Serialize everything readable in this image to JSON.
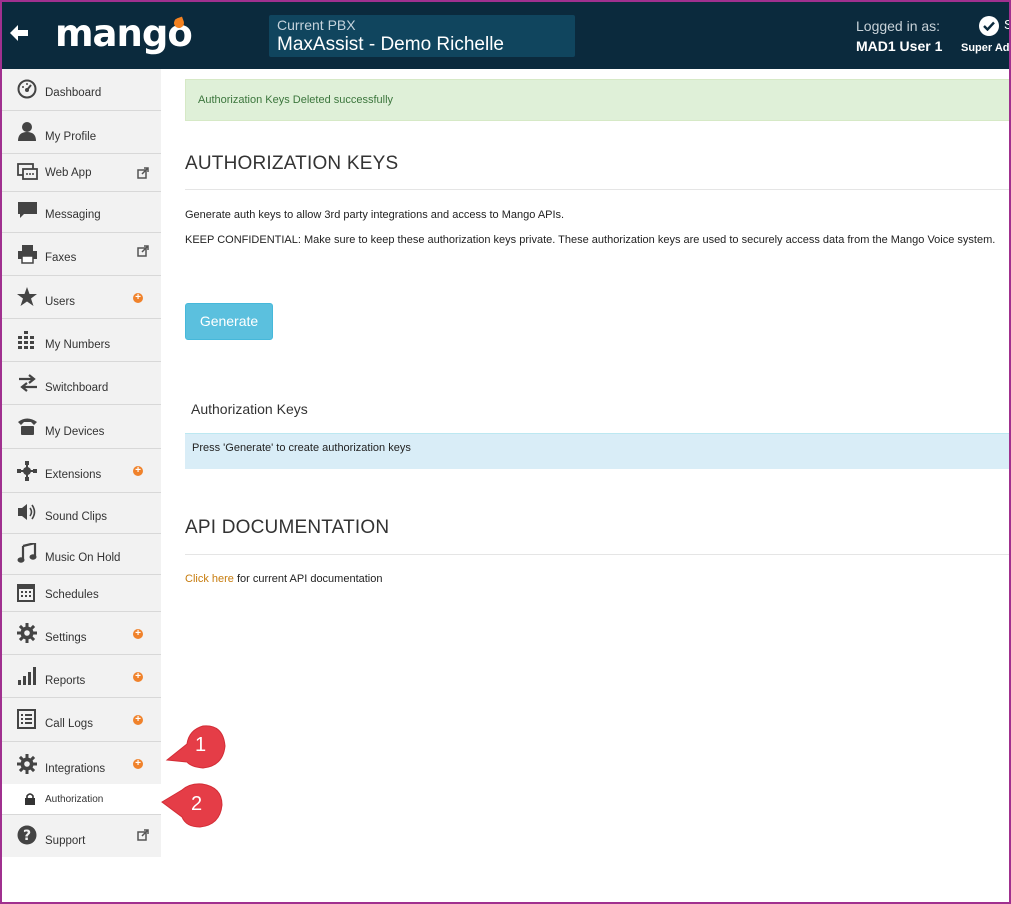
{
  "header": {
    "logo_text": "mango",
    "pbx_caption": "Current PBX",
    "pbx_name": "MaxAssist - Demo Richelle",
    "logged_in_label": "Logged in as:",
    "user_name": "MAD1 User 1",
    "admin_cut_text": "S",
    "admin_label": "Super Admin",
    "bg_color": "#0b2a3d",
    "accent_color": "#f58220"
  },
  "sidebar": {
    "items": [
      {
        "label": "Dashboard",
        "icon": "dashboard-icon"
      },
      {
        "label": "My Profile",
        "icon": "user-icon"
      },
      {
        "label": "Web App",
        "icon": "chat-icon"
      },
      {
        "label": "Messaging",
        "icon": "message-icon"
      },
      {
        "label": "Faxes",
        "icon": "printer-icon"
      },
      {
        "label": "Users",
        "icon": "star-icon"
      },
      {
        "label": "My Numbers",
        "icon": "keypad-icon"
      },
      {
        "label": "Switchboard",
        "icon": "transfer-icon"
      },
      {
        "label": "My Devices",
        "icon": "phone-icon"
      },
      {
        "label": "Extensions",
        "icon": "extensions-icon"
      },
      {
        "label": "Sound Clips",
        "icon": "speaker-icon"
      },
      {
        "label": "Music On Hold",
        "icon": "music-icon"
      },
      {
        "label": "Schedules",
        "icon": "calendar-icon"
      },
      {
        "label": "Settings",
        "icon": "gear-icon"
      },
      {
        "label": "Reports",
        "icon": "bar-chart-icon"
      },
      {
        "label": "Call Logs",
        "icon": "list-icon"
      },
      {
        "label": "Integrations",
        "icon": "gear-icon"
      }
    ],
    "sub_item": {
      "label": "Authorization",
      "icon": "lock-icon"
    },
    "support": {
      "label": "Support",
      "icon": "help-icon"
    }
  },
  "main": {
    "alert_text": "Authorization Keys Deleted successfully",
    "auth_title": "AUTHORIZATION KEYS",
    "desc1": "Generate auth keys to allow 3rd party integrations and access to Mango APIs.",
    "desc2": "KEEP CONFIDENTIAL: Make sure to keep these authorization keys private. These authorization keys are used to securely access data from the Mango Voice system.",
    "generate_label": "Generate",
    "keys_subtitle": "Authorization Keys",
    "keys_info": "Press 'Generate' to create authorization keys",
    "api_title": "API DOCUMENTATION",
    "api_link_text": "Click here",
    "api_suffix": " for current API documentation"
  },
  "callouts": [
    {
      "number": "1"
    },
    {
      "number": "2"
    }
  ]
}
